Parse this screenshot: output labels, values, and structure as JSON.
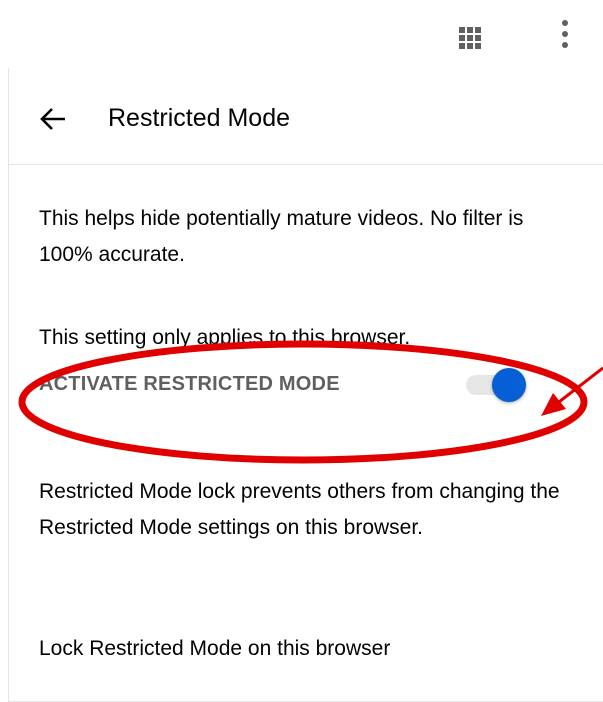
{
  "header": {
    "apps_icon": "apps-grid-icon",
    "more_icon": "more-vertical-icon"
  },
  "panel": {
    "back_icon": "arrow-left-icon",
    "title": "Restricted Mode",
    "description_1": "This helps hide potentially mature videos. No filter is 100% accurate.",
    "description_2": "This setting only applies to this browser.",
    "toggle_label": "ACTIVATE RESTRICTED MODE",
    "toggle_on": true,
    "lock_description": "Restricted Mode lock prevents others from changing the Restricted Mode settings on this browser.",
    "lock_label": "Lock Restricted Mode on this browser"
  },
  "colors": {
    "toggle_knob": "#065fd4",
    "toggle_track": "#e6e6e6",
    "annotation": "#e00000",
    "text": "#030303",
    "muted_text": "#606060"
  }
}
